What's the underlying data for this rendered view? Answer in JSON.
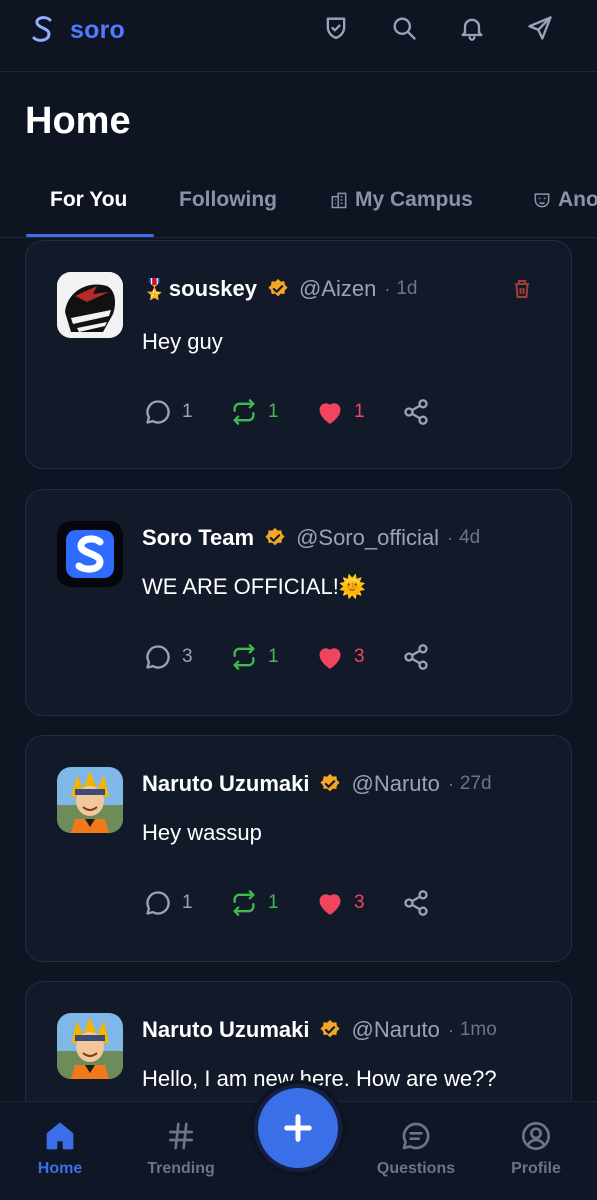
{
  "app": {
    "brand": "soro"
  },
  "header": {
    "title": "Home"
  },
  "tabs": [
    {
      "label": "For You",
      "active": true
    },
    {
      "label": "Following"
    },
    {
      "label": "My Campus",
      "icon": "building-icon"
    },
    {
      "label": "Ano",
      "icon": "mask-icon"
    }
  ],
  "posts": [
    {
      "author": "souskey",
      "badge": "🎖️",
      "handle": "@Aizen",
      "time": "1d",
      "text": "Hey guy",
      "comments": "1",
      "reposts": "1",
      "likes": "1",
      "deletable": true
    },
    {
      "author": "Soro Team",
      "handle": "@Soro_official",
      "time": "4d",
      "text": "WE ARE OFFICIAL!🌞",
      "comments": "3",
      "reposts": "1",
      "likes": "3"
    },
    {
      "author": "Naruto Uzumaki",
      "handle": "@Naruto",
      "time": "27d",
      "text": "Hey wassup",
      "comments": "1",
      "reposts": "1",
      "likes": "3"
    },
    {
      "author": "Naruto Uzumaki",
      "handle": "@Naruto",
      "time": "1mo",
      "text": "Hello, I am new here. How are we??"
    }
  ],
  "nav": {
    "home": "Home",
    "trending": "Trending",
    "questions": "Questions",
    "profile": "Profile"
  },
  "colors": {
    "accent": "#3b6fe8",
    "background": "#0e1422",
    "verified": "#f5a623",
    "like": "#f0445f",
    "repost": "#3fb950"
  }
}
